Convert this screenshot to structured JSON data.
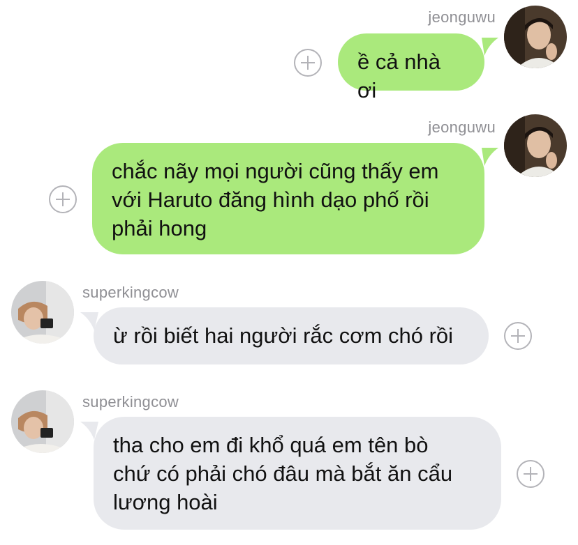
{
  "colors": {
    "sent_bubble": "#aae97c",
    "received_bubble": "#e8e9ed",
    "username": "#8e8e93"
  },
  "messages": [
    {
      "sender": "jeonguwu",
      "direction": "sent",
      "text": "ề cả nhà ơi",
      "icon": "add-circle-icon"
    },
    {
      "sender": "jeonguwu",
      "direction": "sent",
      "text": "chắc nãy mọi người cũng thấy em\nvới Haruto đăng hình dạo phố rồi\nphải hong",
      "icon": "add-circle-icon"
    },
    {
      "sender": "superkingcow",
      "direction": "received",
      "text": "ừ rồi biết hai người rắc cơm chó rồi",
      "icon": "add-circle-icon"
    },
    {
      "sender": "superkingcow",
      "direction": "received",
      "text": "tha cho em đi khổ quá em tên bò\nchứ có phải chó đâu mà bắt ăn cẩu\nlương hoài",
      "icon": "add-circle-icon"
    }
  ]
}
